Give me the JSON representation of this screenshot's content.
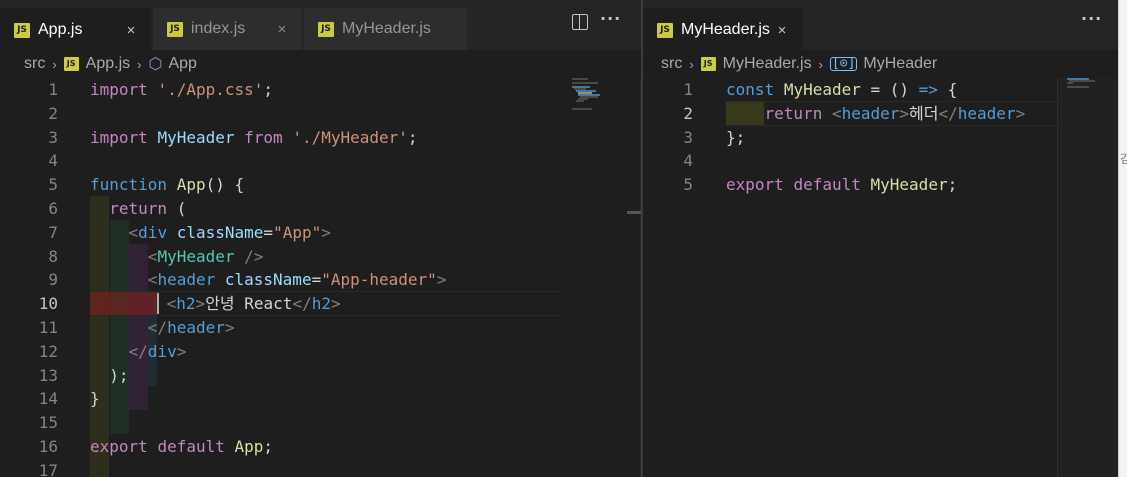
{
  "colors": {
    "background": "#1e1e1e",
    "tabbar": "#252526",
    "keyword": "#569cd6",
    "control": "#c586c0",
    "function": "#dcdcaa",
    "string": "#ce9178",
    "component": "#4ec9b0",
    "attribute": "#9cdcfe",
    "js_badge": "#cbcb41"
  },
  "left": {
    "tabs": [
      {
        "label": "App.js",
        "active": true,
        "icon": "js-file-icon",
        "badge": "JS"
      },
      {
        "label": "index.js",
        "active": false,
        "icon": "js-file-icon",
        "badge": "JS"
      },
      {
        "label": "MyHeader.js",
        "active": false,
        "icon": "js-file-icon",
        "badge": "JS"
      }
    ],
    "breadcrumb": {
      "folder": "src",
      "file": "App.js",
      "file_badge": "JS",
      "symbol": "App",
      "symbol_icon": "component-cube-icon"
    },
    "lines": [
      {
        "n": "1"
      },
      {
        "n": "2"
      },
      {
        "n": "3"
      },
      {
        "n": "4"
      },
      {
        "n": "5"
      },
      {
        "n": "6"
      },
      {
        "n": "7"
      },
      {
        "n": "8"
      },
      {
        "n": "9"
      },
      {
        "n": "10"
      },
      {
        "n": "11"
      },
      {
        "n": "12"
      },
      {
        "n": "13"
      },
      {
        "n": "14"
      },
      {
        "n": "15"
      },
      {
        "n": "16"
      },
      {
        "n": "17"
      }
    ],
    "current_line": "10",
    "code": {
      "l1": {
        "kw": "import",
        "str": "'./App.css'",
        "semi": ";"
      },
      "l3": {
        "kw": "import",
        "name": "MyHeader",
        "from": "from",
        "str": "'./MyHeader'",
        "semi": ";"
      },
      "l5": {
        "kw": "function",
        "name": "App",
        "rest": "() {"
      },
      "l6": {
        "kw": "return",
        "rest": "("
      },
      "l7": {
        "open": "<",
        "tag": "div",
        "attr": "className",
        "eq": "=",
        "str": "\"App\"",
        "close": ">"
      },
      "l8": {
        "open": "<",
        "comp": "MyHeader",
        "close": " />"
      },
      "l9": {
        "open": "<",
        "tag": "header",
        "attr": "className",
        "eq": "=",
        "str": "\"App-header\"",
        "close": ">"
      },
      "l10": {
        "open": "<",
        "tag": "h2",
        "close": ">",
        "text": "안녕 React",
        "end_open": "</",
        "end_tag": "h2",
        "end_close": ">"
      },
      "l11": {
        "open": "</",
        "tag": "header",
        "close": ">"
      },
      "l12": {
        "open": "</",
        "tag": "div",
        "close": ">"
      },
      "l13": {
        "text": ");"
      },
      "l14": {
        "text": "}"
      },
      "l16": {
        "kw1": "export",
        "kw2": "default",
        "name": "App",
        "semi": ";"
      }
    }
  },
  "right": {
    "tabs": [
      {
        "label": "MyHeader.js",
        "active": true,
        "icon": "js-file-icon",
        "badge": "JS"
      }
    ],
    "breadcrumb": {
      "folder": "src",
      "file": "MyHeader.js",
      "file_badge": "JS",
      "symbol": "MyHeader",
      "symbol_icon": "variable-symbol-icon",
      "symbol_glyph": "[⊙]"
    },
    "lines": [
      {
        "n": "1"
      },
      {
        "n": "2"
      },
      {
        "n": "3"
      },
      {
        "n": "4"
      },
      {
        "n": "5"
      }
    ],
    "current_line": "2",
    "code": {
      "l1": {
        "kw": "const",
        "name": "MyHeader",
        "eq": " = () ",
        "arrow": "=>",
        "rest": " {"
      },
      "l2": {
        "kw": "return",
        "open": "<",
        "tag": "header",
        "close": ">",
        "text": "헤더",
        "end_open": "</",
        "end_tag": "header",
        "end_close": ">"
      },
      "l3": {
        "text": "};"
      },
      "l5": {
        "kw1": "export",
        "kw2": "default",
        "name": "MyHeader",
        "semi": ";"
      }
    }
  },
  "actions": {
    "split_icon": "split-editor-icon",
    "more_icon": "more-actions-icon",
    "more_glyph": "···"
  },
  "close_glyph": "×",
  "chevron_glyph": "›",
  "outside_glyph": "김"
}
